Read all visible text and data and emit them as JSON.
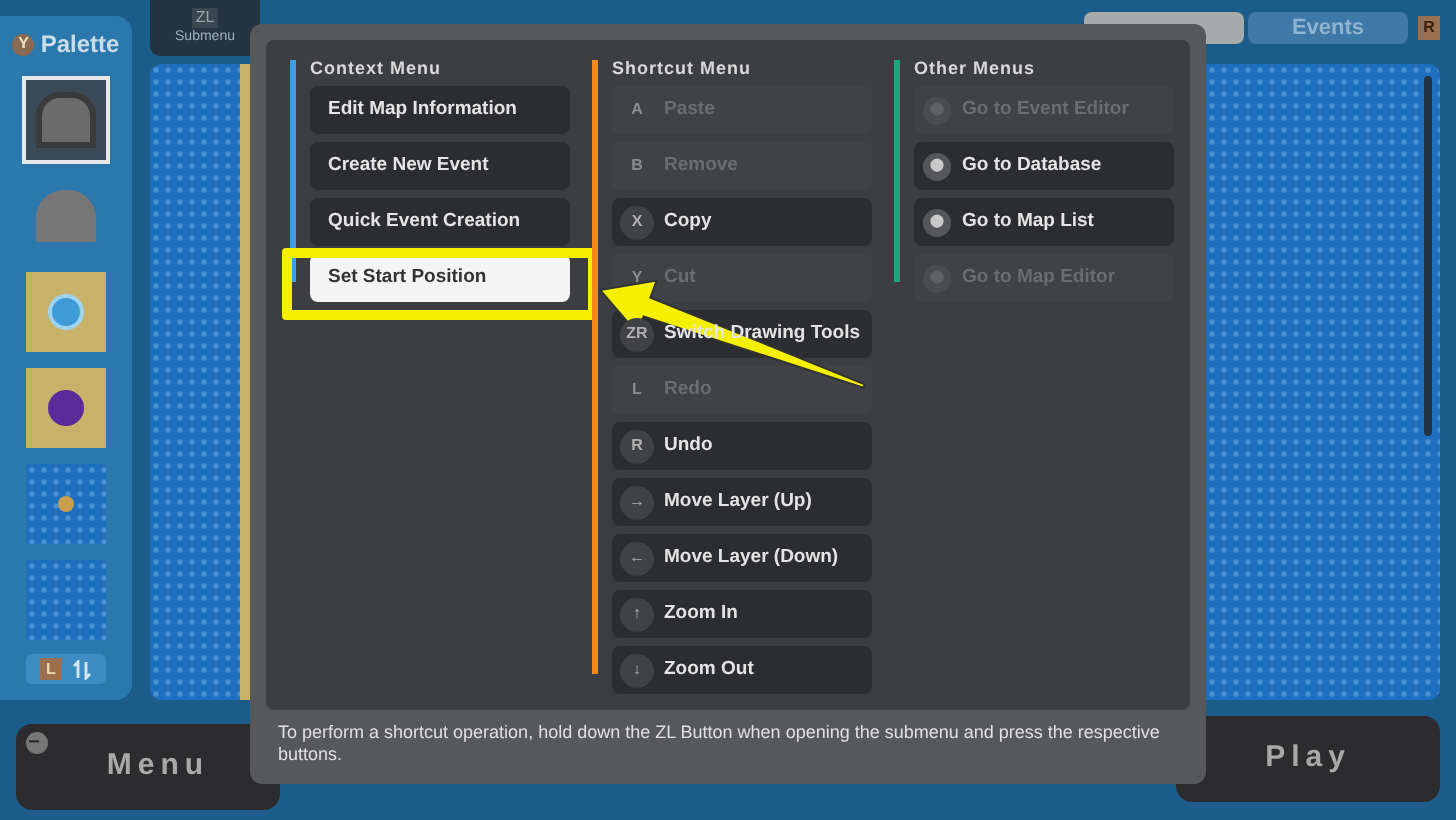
{
  "palette": {
    "key": "Y",
    "title": "Palette",
    "tiles": [
      {
        "selected": true
      },
      {
        "selected": false
      },
      {
        "selected": false
      },
      {
        "selected": false
      },
      {
        "selected": false
      },
      {
        "selected": false
      }
    ],
    "footer_key": "L"
  },
  "submenu_tab": {
    "key": "ZL",
    "label": "Submenu"
  },
  "view_tabs": [
    {
      "selected": true
    },
    {
      "label": "Events",
      "selected": false
    }
  ],
  "view_tabs_key": "R",
  "dialog": {
    "columns": [
      {
        "title": "Context Menu",
        "color": "#3a9ee8",
        "items": [
          {
            "label": "Edit Map Information",
            "selected": false
          },
          {
            "label": "Create New Event",
            "selected": false
          },
          {
            "label": "Quick Event Creation",
            "selected": false
          },
          {
            "label": "Set Start Position",
            "selected": true
          }
        ]
      },
      {
        "title": "Shortcut Menu",
        "color": "#f08a24",
        "items": [
          {
            "key": "A",
            "label": "Paste",
            "disabled": true
          },
          {
            "key": "B",
            "label": "Remove",
            "disabled": true
          },
          {
            "key": "X",
            "label": "Copy",
            "disabled": false
          },
          {
            "key": "Y",
            "label": "Cut",
            "disabled": true
          },
          {
            "key": "ZR",
            "label": "Switch Drawing Tools",
            "disabled": false
          },
          {
            "key": "L",
            "label": "Redo",
            "disabled": true
          },
          {
            "key": "R",
            "label": "Undo",
            "disabled": false
          },
          {
            "key": "→",
            "label": "Move Layer (Up)",
            "disabled": false
          },
          {
            "key": "←",
            "label": "Move Layer (Down)",
            "disabled": false
          },
          {
            "key": "↑",
            "label": "Zoom In",
            "disabled": false
          },
          {
            "key": "↓",
            "label": "Zoom Out",
            "disabled": false
          }
        ]
      },
      {
        "title": "Other Menus",
        "color": "#1fa57a",
        "items": [
          {
            "label": "Go to Event Editor",
            "disabled": true
          },
          {
            "label": "Go to Database",
            "disabled": false
          },
          {
            "label": "Go to Map List",
            "disabled": false
          },
          {
            "label": "Go to Map Editor",
            "disabled": true
          }
        ]
      }
    ],
    "hint": "To perform a shortcut operation, hold down the ZL Button when opening the submenu and press the respective buttons."
  },
  "bottom_buttons": [
    {
      "label": "Menu",
      "key": "−"
    },
    {
      "label": "Play"
    }
  ]
}
